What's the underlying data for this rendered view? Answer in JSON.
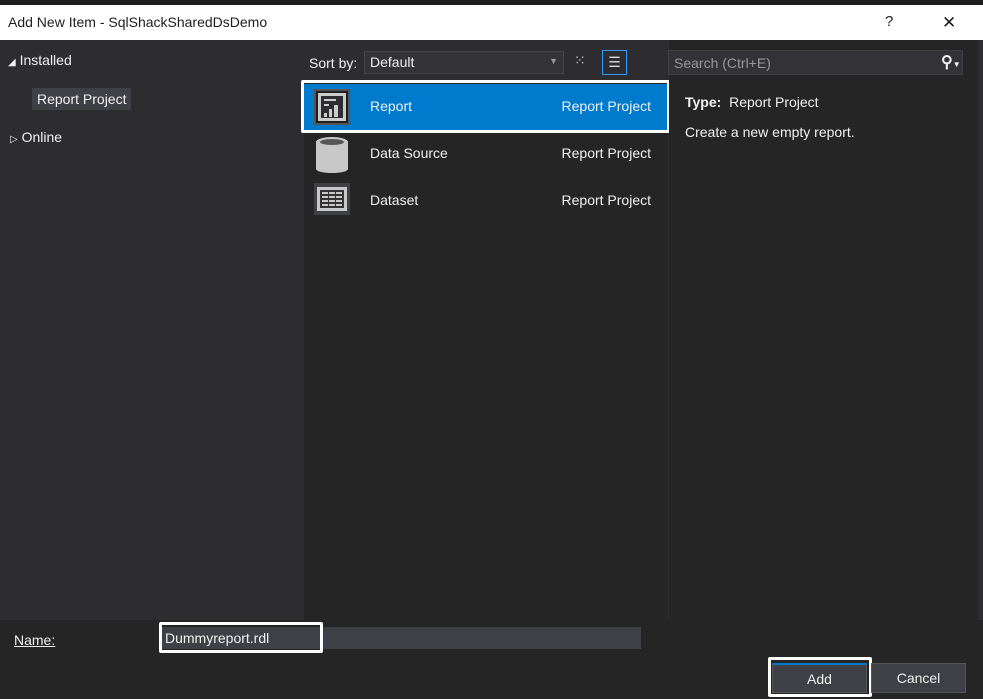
{
  "dialog": {
    "title": "Add New Item - SqlShackSharedDsDemo",
    "help": "?",
    "close": "X"
  },
  "tree": {
    "installed": "Installed",
    "report_project": "Report Project",
    "online": "Online"
  },
  "toolbar": {
    "sort_label": "Sort by:",
    "sort_value": "Default",
    "search_placeholder": "Search (Ctrl+E)"
  },
  "items": [
    {
      "name": "Report",
      "type": "Report Project",
      "selected": true
    },
    {
      "name": "Data Source",
      "type": "Report Project"
    },
    {
      "name": "Dataset",
      "type": "Report Project"
    }
  ],
  "details": {
    "type_label": "Type:",
    "type_value": "Report Project",
    "description": "Create a new empty report."
  },
  "footer": {
    "name_label": "Name:",
    "name_value": "Dummyreport.rdl",
    "add": "Add",
    "cancel": "Cancel"
  },
  "colors": {
    "accent": "#007acc"
  }
}
